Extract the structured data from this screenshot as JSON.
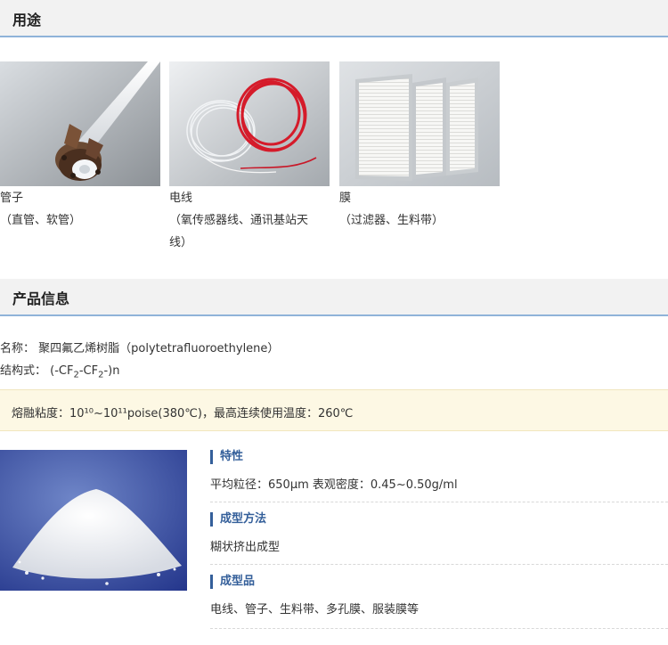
{
  "uses": {
    "title": "用途",
    "items": [
      {
        "label": "管子",
        "sub": [
          "（直管、软管）"
        ]
      },
      {
        "label": "电线",
        "sub": [
          "（氧传感器线、通讯基站天",
          "线）"
        ]
      },
      {
        "label": "膜",
        "sub": [
          "（过滤器、生料带）"
        ]
      }
    ]
  },
  "product": {
    "title": "产品信息",
    "name_line": "名称：  聚四氟乙烯树脂（polytetrafluoroethylene）",
    "structure_prefix": "结构式：  (-CF",
    "structure_sub1": "2",
    "structure_mid": "-CF",
    "structure_sub2": "2",
    "structure_suffix": "-)n",
    "note": "熔融粘度：10¹⁰~10¹¹poise(380℃)，最高连续使用温度：260℃"
  },
  "properties": [
    {
      "title": "特性",
      "value": "平均粒径：650μm 表观密度：0.45~0.50g/ml"
    },
    {
      "title": "成型方法",
      "value": "糊状挤出成型"
    },
    {
      "title": "成型品",
      "value": "电线、管子、生料带、多孔膜、服装膜等"
    }
  ]
}
